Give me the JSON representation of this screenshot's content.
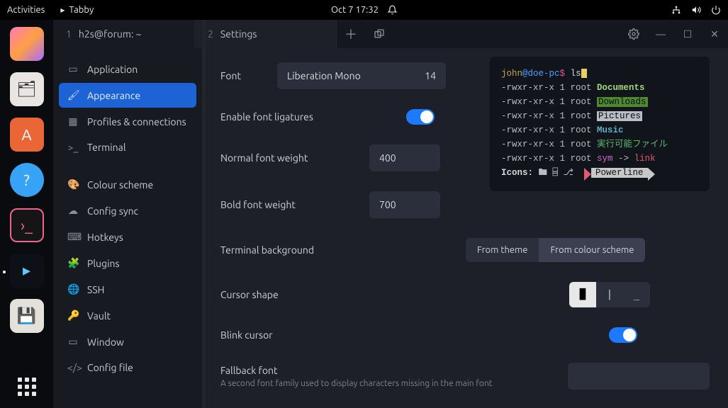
{
  "topbar": {
    "activities": "Activities",
    "app": "Tabby",
    "datetime": "Oct 7  17:32"
  },
  "tabs": {
    "t1_num": "1",
    "t1_label": "h2s@forum: ~",
    "t2_num": "2",
    "t2_label": "Settings"
  },
  "sidebar": {
    "items": [
      {
        "icon": "▭",
        "label": "Application"
      },
      {
        "icon": "🖌",
        "label": "Appearance"
      },
      {
        "icon": "▦",
        "label": "Profiles & connections"
      },
      {
        "icon": ">_",
        "label": "Terminal"
      },
      {
        "icon": "🎨",
        "label": "Colour scheme"
      },
      {
        "icon": "☁",
        "label": "Config sync"
      },
      {
        "icon": "⌨",
        "label": "Hotkeys"
      },
      {
        "icon": "🧩",
        "label": "Plugins"
      },
      {
        "icon": "🌐",
        "label": "SSH"
      },
      {
        "icon": "🔑",
        "label": "Vault"
      },
      {
        "icon": "▭",
        "label": "Window"
      },
      {
        "icon": "</>",
        "label": "Config file"
      }
    ]
  },
  "settings": {
    "font_label": "Font",
    "font_name": "Liberation Mono",
    "font_size": "14",
    "ligatures_label": "Enable font ligatures",
    "normal_weight_label": "Normal font weight",
    "normal_weight": "400",
    "bold_weight_label": "Bold font weight",
    "bold_weight": "700",
    "termbg_label": "Terminal background",
    "termbg_opt1": "From theme",
    "termbg_opt2": "From colour scheme",
    "cursor_label": "Cursor shape",
    "blink_label": "Blink cursor",
    "fallback_label": "Fallback font",
    "fallback_sub": "A second font family used to display characters missing in the main font"
  },
  "preview": {
    "user": "john",
    "at": "@",
    "host": "doe-pc",
    "prompt": "$",
    "cmd": "ls",
    "perm": "-rwxr-xr-x 1 root",
    "files": [
      "Documents",
      "Downloads",
      "Pictures",
      "Music",
      "実行可能ファイル"
    ],
    "sym": "sym",
    "arrow": "->",
    "link": "link",
    "icons_label": "Icons:",
    "icons": "🖿 ⌸ ⎇",
    "powerline": "Powerline"
  }
}
